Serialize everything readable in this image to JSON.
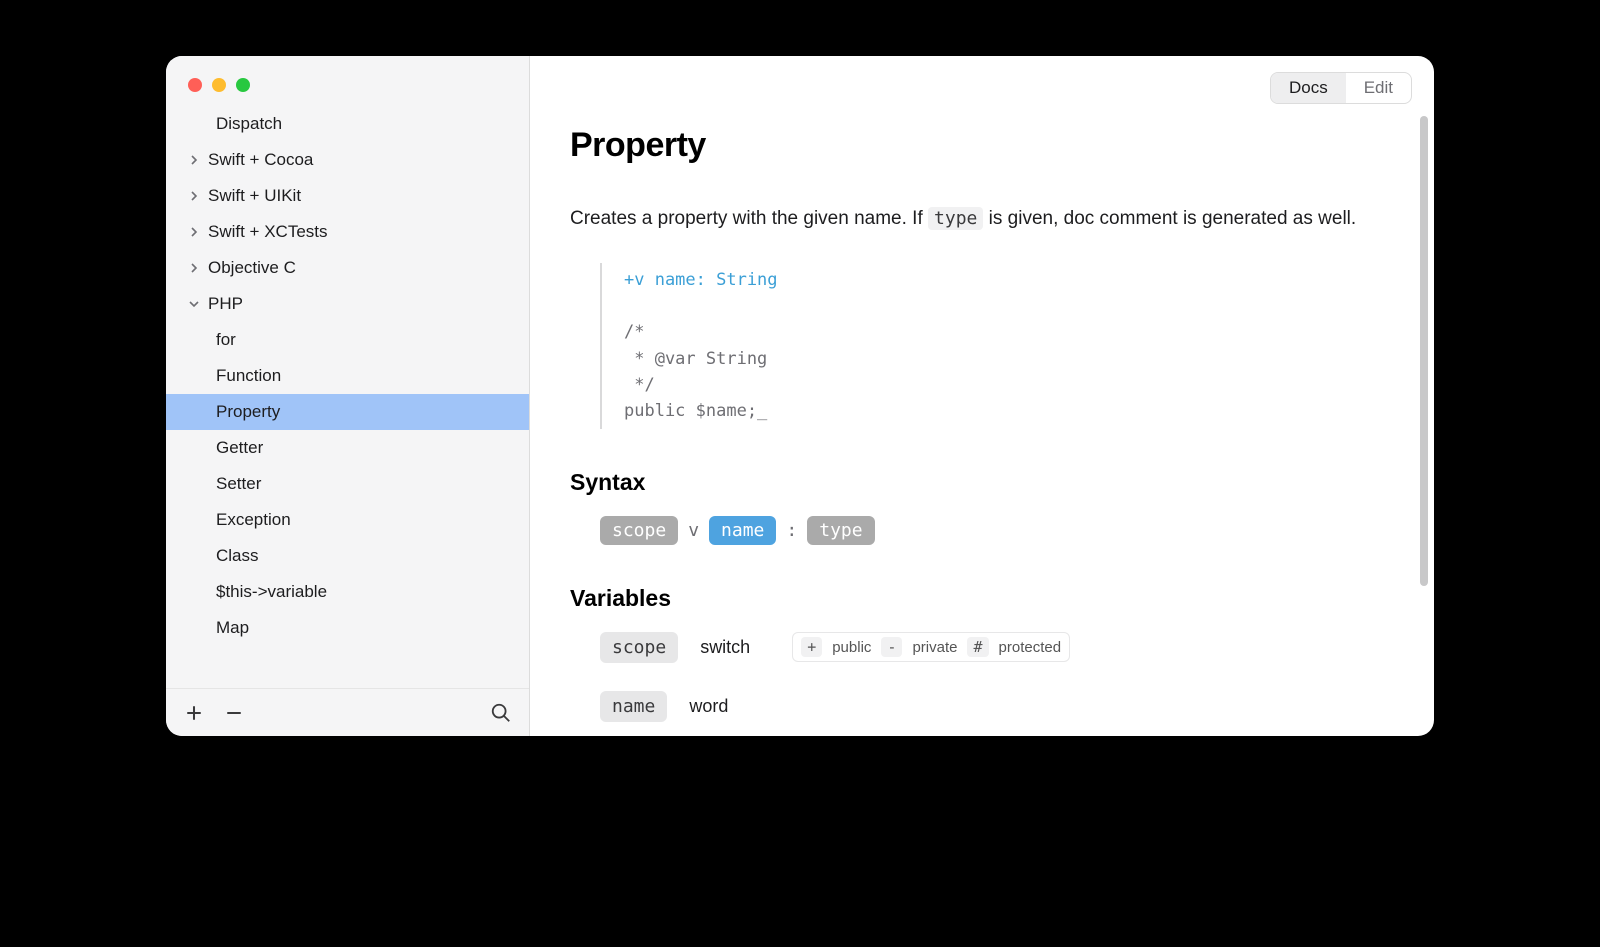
{
  "toggle": {
    "docs": "Docs",
    "edit": "Edit"
  },
  "sidebar": {
    "items": [
      {
        "label": "Dispatch",
        "level": 2,
        "expandable": false,
        "expanded": false,
        "selected": false
      },
      {
        "label": "Swift + Cocoa",
        "level": 1,
        "expandable": true,
        "expanded": false,
        "selected": false
      },
      {
        "label": "Swift + UIKit",
        "level": 1,
        "expandable": true,
        "expanded": false,
        "selected": false
      },
      {
        "label": "Swift + XCTests",
        "level": 1,
        "expandable": true,
        "expanded": false,
        "selected": false
      },
      {
        "label": "Objective C",
        "level": 1,
        "expandable": true,
        "expanded": false,
        "selected": false
      },
      {
        "label": "PHP",
        "level": 1,
        "expandable": true,
        "expanded": true,
        "selected": false
      },
      {
        "label": "for",
        "level": 2,
        "expandable": false,
        "expanded": false,
        "selected": false
      },
      {
        "label": "Function",
        "level": 2,
        "expandable": false,
        "expanded": false,
        "selected": false
      },
      {
        "label": "Property",
        "level": 2,
        "expandable": false,
        "expanded": false,
        "selected": true
      },
      {
        "label": "Getter",
        "level": 2,
        "expandable": false,
        "expanded": false,
        "selected": false
      },
      {
        "label": "Setter",
        "level": 2,
        "expandable": false,
        "expanded": false,
        "selected": false
      },
      {
        "label": "Exception",
        "level": 2,
        "expandable": false,
        "expanded": false,
        "selected": false
      },
      {
        "label": "Class",
        "level": 2,
        "expandable": false,
        "expanded": false,
        "selected": false
      },
      {
        "label": "$this->variable",
        "level": 2,
        "expandable": false,
        "expanded": false,
        "selected": false
      },
      {
        "label": "Map",
        "level": 2,
        "expandable": false,
        "expanded": false,
        "selected": false
      }
    ]
  },
  "page": {
    "title": "Property",
    "desc_before": "Creates a property with the given name. If ",
    "desc_code": "type",
    "desc_after": " is given, doc comment is generated as well.",
    "code_hl": "+v name: String",
    "code_rest": "/*\n * @var String\n */\npublic $name;_",
    "syntax_heading": "Syntax",
    "syntax": {
      "scope": "scope",
      "v": "v",
      "name": "name",
      "colon": ":",
      "type": "type"
    },
    "vars_heading": "Variables",
    "vars": [
      {
        "name": "scope",
        "kind": "switch",
        "options": [
          {
            "key": "+",
            "val": "public"
          },
          {
            "key": "-",
            "val": "private"
          },
          {
            "key": "#",
            "val": "protected"
          }
        ]
      },
      {
        "name": "name",
        "kind": "word",
        "options": []
      }
    ]
  }
}
